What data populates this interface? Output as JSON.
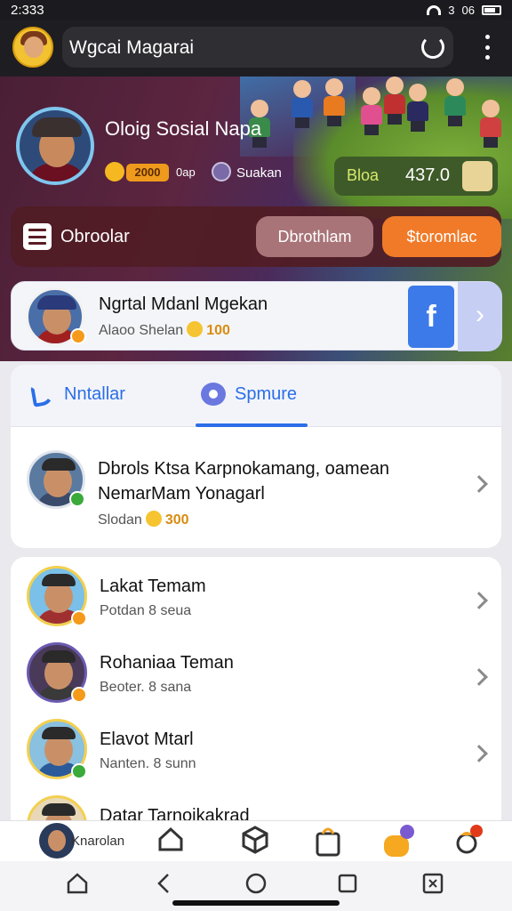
{
  "status_bar": {
    "time": "2:333",
    "signal_text": "3",
    "battery_text": "06"
  },
  "app_bar": {
    "title": "Wgcai Magarai"
  },
  "profile": {
    "name": "Oloig Sosial Napa",
    "coin_value": "2000",
    "coin_unit": "0ap",
    "sub_label": "Suakan",
    "stat_label": "Bloa",
    "stat_value": "437.0"
  },
  "actions": {
    "menu_label": "Obroolar",
    "secondary": "Dbrothlam",
    "primary": "$toromlac"
  },
  "featured": {
    "name": "Ngrtal Mdanl Mgekan",
    "status": "Alaoo Shelan",
    "coins": "100",
    "social_label": "f"
  },
  "tabs": [
    {
      "label": "Nntallar",
      "icon": "phone-icon",
      "active": false
    },
    {
      "label": "Spmure",
      "icon": "chat-icon",
      "active": true
    }
  ],
  "message": {
    "line1": "Dbrols Ktsa Karpnokamang, oamean",
    "line2": "NemarMam Yonagarl",
    "status": "Slodan",
    "coins": "300"
  },
  "friends": [
    {
      "name": "Lakat Temam",
      "status": "Potdan 8 seua",
      "badge_color": "#f59a1a"
    },
    {
      "name": "Rohaniaa Teman",
      "status": "Beoter. 8 sana",
      "badge_color": "#f59a1a"
    },
    {
      "name": "Elavot Mtarl",
      "status": "Nanten. 8 sunn",
      "badge_color": "#3aaa3a"
    },
    {
      "name": "Datar Tarnoikakrad",
      "status": "",
      "badge_color": "#f59a1a"
    }
  ],
  "bottom_nav": {
    "label": "Knarolan"
  },
  "colors": {
    "accent": "#2a6ee8",
    "primary_button": "#f07a28",
    "facebook": "#3b7ae8"
  }
}
